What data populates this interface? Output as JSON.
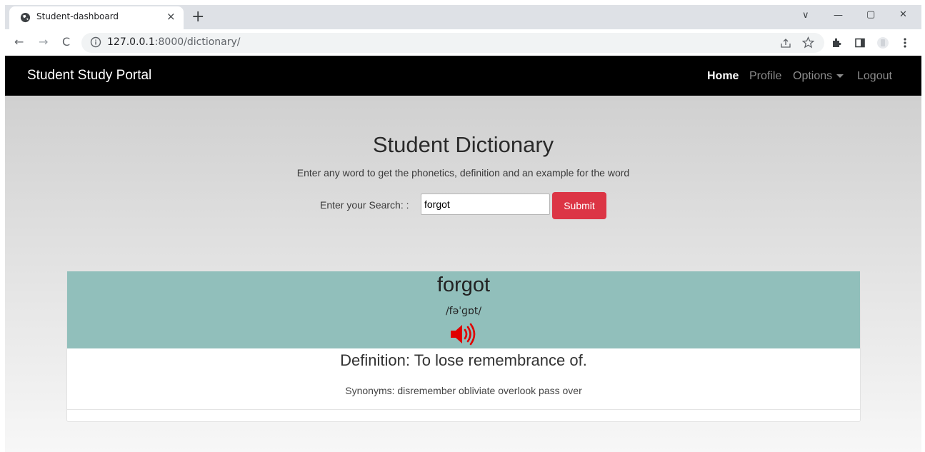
{
  "browser": {
    "tab_title": "Student-dashboard",
    "tab_close": "×",
    "new_tab": "+",
    "url_host": "127.0.0.1",
    "url_path": ":8000/dictionary/",
    "back": "←",
    "forward": "→",
    "reload": "C",
    "win_min": "—",
    "win_max": "▢",
    "win_close": "✕",
    "win_down": "∨"
  },
  "navbar": {
    "brand": "Student Study Portal",
    "links": [
      "Home",
      "Profile",
      "Options",
      "Logout"
    ]
  },
  "page": {
    "title": "Student Dictionary",
    "subtitle": "Enter any word to get the phonetics, definition and an example for the word",
    "search_label": "Enter your Search: :",
    "search_value": "forgot",
    "submit_label": "Submit"
  },
  "result": {
    "word": "forgot",
    "phonetic": "/fəˈɡɒt/",
    "definition": "Definition: To lose remembrance of.",
    "synonyms": "Synonyms: disremember obliviate overlook pass over"
  },
  "colors": {
    "navbar_bg": "#000000",
    "submit_bg": "#dc3545",
    "result_header_bg": "#91bfbb",
    "audio_icon": "#e00000"
  }
}
